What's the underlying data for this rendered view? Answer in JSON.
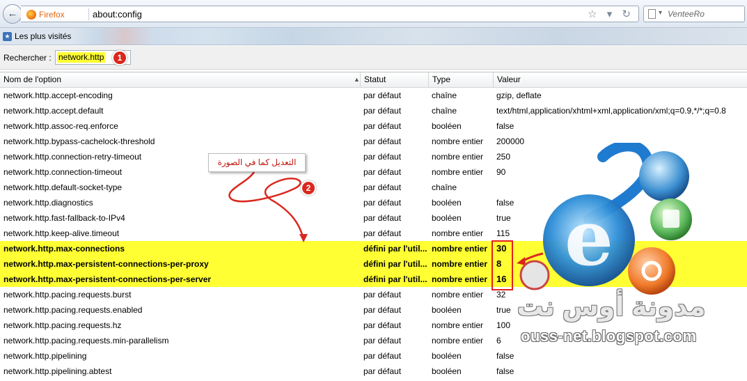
{
  "browser": {
    "brand_label": "Firefox",
    "url": "about:config",
    "search_placeholder": "VenteeRo",
    "back_glyph": "←",
    "url_icons": "☆ ▾ ↻",
    "search_dropdown_glyph": "▾"
  },
  "bookmarks": {
    "most_visited_label": "Les plus visités"
  },
  "search": {
    "label": "Rechercher :",
    "value": "network.http"
  },
  "table": {
    "columns": {
      "name": "Nom de l'option",
      "status": "Statut",
      "type": "Type",
      "value": "Valeur"
    },
    "rows": [
      {
        "name": "network.http.accept-encoding",
        "status": "par défaut",
        "type": "chaîne",
        "value": "gzip, deflate",
        "highlighted": false
      },
      {
        "name": "network.http.accept.default",
        "status": "par défaut",
        "type": "chaîne",
        "value": "text/html,application/xhtml+xml,application/xml;q=0.9,*/*;q=0.8",
        "highlighted": false
      },
      {
        "name": "network.http.assoc-req.enforce",
        "status": "par défaut",
        "type": "booléen",
        "value": "false",
        "highlighted": false
      },
      {
        "name": "network.http.bypass-cachelock-threshold",
        "status": "par défaut",
        "type": "nombre entier",
        "value": "200000",
        "highlighted": false
      },
      {
        "name": "network.http.connection-retry-timeout",
        "status": "par défaut",
        "type": "nombre entier",
        "value": "250",
        "highlighted": false
      },
      {
        "name": "network.http.connection-timeout",
        "status": "par défaut",
        "type": "nombre entier",
        "value": "90",
        "highlighted": false
      },
      {
        "name": "network.http.default-socket-type",
        "status": "par défaut",
        "type": "chaîne",
        "value": "",
        "highlighted": false
      },
      {
        "name": "network.http.diagnostics",
        "status": "par défaut",
        "type": "booléen",
        "value": "false",
        "highlighted": false
      },
      {
        "name": "network.http.fast-fallback-to-IPv4",
        "status": "par défaut",
        "type": "booléen",
        "value": "true",
        "highlighted": false
      },
      {
        "name": "network.http.keep-alive.timeout",
        "status": "par défaut",
        "type": "nombre entier",
        "value": "115",
        "highlighted": false
      },
      {
        "name": "network.http.max-connections",
        "status": "défini par l'util...",
        "type": "nombre entier",
        "value": "30",
        "highlighted": true
      },
      {
        "name": "network.http.max-persistent-connections-per-proxy",
        "status": "défini par l'util...",
        "type": "nombre entier",
        "value": "8",
        "highlighted": true
      },
      {
        "name": "network.http.max-persistent-connections-per-server",
        "status": "défini par l'util...",
        "type": "nombre entier",
        "value": "16",
        "highlighted": true
      },
      {
        "name": "network.http.pacing.requests.burst",
        "status": "par défaut",
        "type": "nombre entier",
        "value": "32",
        "highlighted": false
      },
      {
        "name": "network.http.pacing.requests.enabled",
        "status": "par défaut",
        "type": "booléen",
        "value": "true",
        "highlighted": false
      },
      {
        "name": "network.http.pacing.requests.hz",
        "status": "par défaut",
        "type": "nombre entier",
        "value": "100",
        "highlighted": false
      },
      {
        "name": "network.http.pacing.requests.min-parallelism",
        "status": "par défaut",
        "type": "nombre entier",
        "value": "6",
        "highlighted": false
      },
      {
        "name": "network.http.pipelining",
        "status": "par défaut",
        "type": "booléen",
        "value": "false",
        "highlighted": false
      },
      {
        "name": "network.http.pipelining.abtest",
        "status": "par défaut",
        "type": "booléen",
        "value": "false",
        "highlighted": false
      }
    ]
  },
  "annotations": {
    "step1": "1",
    "step2": "2",
    "callout": "التعديل كما في الصورة"
  },
  "watermark": {
    "arabic": "مدونة أوس نت",
    "url": "ouss-net.blogspot.com"
  },
  "colors": {
    "highlight": "#ffff33",
    "annotation_red": "#d9281e",
    "firefox_orange": "#e0660e"
  }
}
